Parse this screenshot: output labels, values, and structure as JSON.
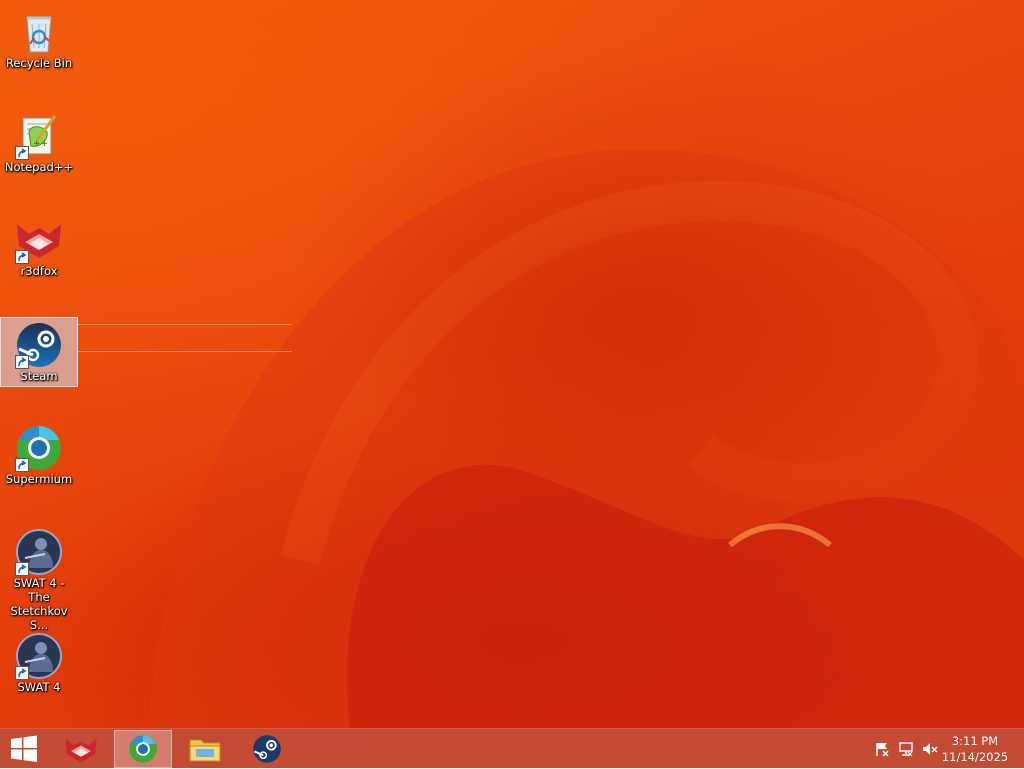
{
  "desktop": {
    "icons": [
      {
        "label": "Recycle Bin",
        "icon": "recycle-bin-icon",
        "shortcut": false,
        "selected": false
      },
      {
        "label": "Notepad++",
        "icon": "notepad-plus-plus-icon",
        "shortcut": true,
        "selected": false
      },
      {
        "label": "r3dfox",
        "icon": "r3dfox-icon",
        "shortcut": true,
        "selected": false
      },
      {
        "label": "Steam",
        "icon": "steam-icon",
        "shortcut": true,
        "selected": true
      },
      {
        "label": "Supermium",
        "icon": "supermium-icon",
        "shortcut": true,
        "selected": false
      },
      {
        "label": "SWAT 4 - The Stetchkov S...",
        "icon": "swat4-stetchkov-icon",
        "shortcut": true,
        "selected": false
      },
      {
        "label": "SWAT 4",
        "icon": "swat4-icon",
        "shortcut": true,
        "selected": false
      }
    ]
  },
  "taskbar": {
    "start": "windows-start-icon",
    "pinned": [
      {
        "name": "r3dfox",
        "icon": "r3dfox-icon",
        "active": false
      },
      {
        "name": "Supermium",
        "icon": "supermium-icon",
        "active": true
      },
      {
        "name": "File Explorer",
        "icon": "file-explorer-icon",
        "active": false
      },
      {
        "name": "Steam",
        "icon": "steam-icon",
        "active": false
      }
    ],
    "tray": {
      "icons": [
        "action-center-flag-icon",
        "network-icon",
        "volume-muted-icon"
      ],
      "time": "3:11 PM",
      "date": "11/14/2025"
    }
  }
}
